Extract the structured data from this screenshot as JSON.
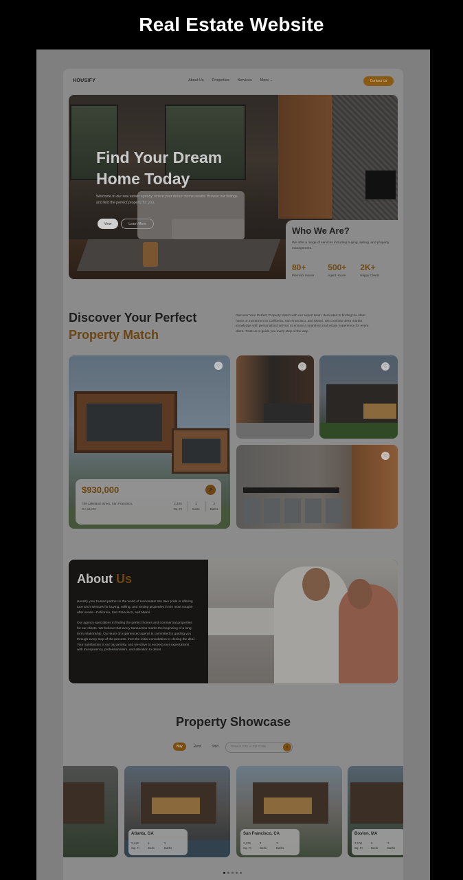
{
  "screen_title": "Real Estate Website",
  "nav": {
    "logo": "HOUSIFY",
    "links": [
      "About Us",
      "Properties",
      "Services",
      "More ⌄"
    ],
    "contact": "Contact Us"
  },
  "hero": {
    "title_line1": "Find Your Dream",
    "title_line2": "Home Today",
    "subtitle": "Welcome to our real estate agency, where your dream home awaits. Browse our listings and find the perfect property for you.",
    "btn_view": "View",
    "btn_learn": "Learn More"
  },
  "who": {
    "title": "Who We Are?",
    "text": "We offer a range of services including buying, selling, and property management.",
    "stats": [
      {
        "num": "80+",
        "label": "Premium House"
      },
      {
        "num": "500+",
        "label": "Agent House"
      },
      {
        "num": "2K+",
        "label": "Happy Clients"
      }
    ]
  },
  "discover": {
    "title1": "Discover Your Perfect",
    "title2": "Property Match",
    "desc": "Discover Your Perfect Property Match with our expert team, dedicated to finding the ideal home or investment in California, San Francisco, and Miami. We combine deep market knowledge with personalized service to ensure a seamless real estate experience for every client. Trust us to guide you every step of the way."
  },
  "featured": {
    "price": "$930,000",
    "address": "789 Lakeland Street, San Francisco, CA 94123",
    "specs": [
      {
        "val": "2,225",
        "unit": "Sq. Ft"
      },
      {
        "val": "3",
        "unit": "Beds"
      },
      {
        "val": "3",
        "unit": "Baths"
      }
    ]
  },
  "about": {
    "title_a": "About ",
    "title_b": "Us",
    "p1": "Housify your trusted partner in the world of real estate! We take pride in offering top-notch services for buying, selling, and renting properties in the most sought-after areas—California, San Francisco, and Miami.",
    "p2": "Our agency specializes in finding the perfect homes and commercial properties for our clients. We believe that every transaction marks the beginning of a long-term relationship. Our team of experienced agents is committed to guiding you through every step of the process, from the initial consultation to closing the deal. Your satisfaction is our top priority, and we strive to exceed your expectations with transparency, professionalism, and attention to detail."
  },
  "showcase": {
    "title": "Property Showcase",
    "filters": [
      "Buy",
      "Rent",
      "Sold"
    ],
    "search_placeholder": "Search City or Zip Code",
    "cards": [
      {
        "city": "Atlanta, GA",
        "sqft": "2,125",
        "beds": "5",
        "baths": "2"
      },
      {
        "city": "San Francisco, CA",
        "sqft": "2,225",
        "beds": "3",
        "baths": "3"
      },
      {
        "city": "Boston, MA",
        "sqft": "3,100",
        "beds": "5",
        "baths": "3"
      }
    ],
    "spec_units": [
      "Sq. Ft",
      "Beds",
      "Baths"
    ]
  },
  "colors": {
    "accent": "#7a4e12",
    "overlay": "#7f7f7f",
    "background": "#000000"
  },
  "icons": [
    "heart-icon",
    "arrow-icon",
    "search-icon",
    "chevron-down-icon"
  ]
}
